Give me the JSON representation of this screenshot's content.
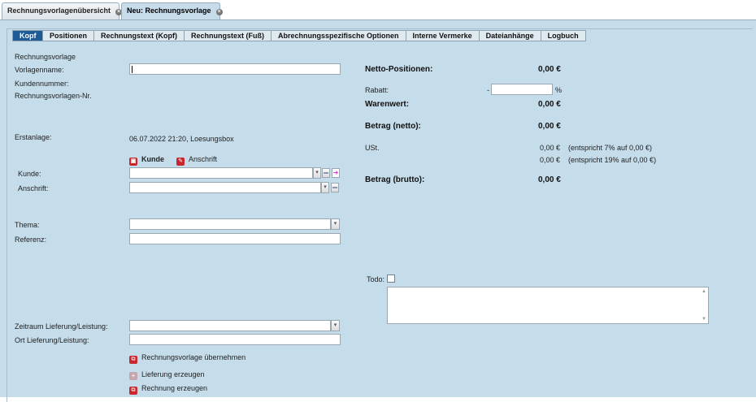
{
  "doc_tabs": [
    {
      "label": "Rechnungsvorlagenübersicht"
    },
    {
      "label": "Neu: Rechnungsvorlage"
    }
  ],
  "sub_tabs": [
    {
      "label": "Kopf"
    },
    {
      "label": "Positionen"
    },
    {
      "label": "Rechnungstext (Kopf)"
    },
    {
      "label": "Rechnungstext (Fuß)"
    },
    {
      "label": "Abrechnungsspezifische Optionen"
    },
    {
      "label": "Interne Vermerke"
    },
    {
      "label": "Dateianhänge"
    },
    {
      "label": "Logbuch"
    }
  ],
  "left": {
    "section_title": "Rechnungsvorlage",
    "vorlagenname_label": "Vorlagenname:",
    "vorlagenname_value": "",
    "kundennummer_label": "Kundennummer:",
    "vorlagen_nr_label": "Rechnungsvorlagen-Nr.",
    "erstanlage_label": "Erstanlage:",
    "erstanlage_value": "06.07.2022 21:20, Loesungsbox",
    "kunde_link": "Kunde",
    "anschrift_link": "Anschrift",
    "kunde_label": "Kunde:",
    "anschrift_label": "Anschrift:",
    "thema_label": "Thema:",
    "referenz_label": "Referenz:",
    "zeitraum_label": "Zeitraum Lieferung/Leistung:",
    "ort_label": "Ort Lieferung/Leistung:",
    "actions": {
      "uebernehmen": "Rechnungsvorlage übernehmen",
      "lieferung": "Lieferung erzeugen",
      "rechnung": "Rechnung erzeugen"
    }
  },
  "right": {
    "netto_positionen_label": "Netto-Positionen:",
    "netto_positionen_value": "0,00 €",
    "rabatt_label": "Rabatt:",
    "rabatt_sign": "-",
    "rabatt_value": "",
    "rabatt_unit": "%",
    "warenwert_label": "Warenwert:",
    "warenwert_value": "0,00 €",
    "betrag_netto_label": "Betrag (netto):",
    "betrag_netto_value": "0,00 €",
    "ust_label": "USt.",
    "ust_lines": [
      {
        "value": "0,00 €",
        "note": "(entspricht 7% auf 0,00 €)"
      },
      {
        "value": "0,00 €",
        "note": "(entspricht 19% auf 0,00 €)"
      }
    ],
    "betrag_brutto_label": "Betrag (brutto):",
    "betrag_brutto_value": "0,00 €",
    "todo_label": "Todo:",
    "todo_checked": false
  },
  "icons": {
    "close": "close-icon",
    "dropdown": "chevron-down-icon",
    "red_doc": "document-icon",
    "edit": "pencil-icon",
    "plus": "plus-icon"
  },
  "colors": {
    "panel_bg": "#c5dcea",
    "active_tab": "#1f5a96",
    "action_red": "#c8282d"
  }
}
